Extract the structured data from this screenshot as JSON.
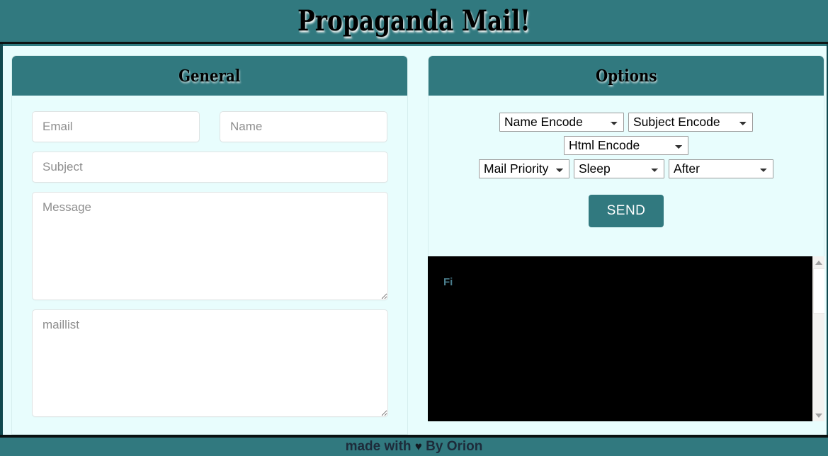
{
  "app": {
    "title": "Propaganda Mail!",
    "theme": {
      "teal": "#31797f",
      "panel_bg": "#e8fdfd",
      "console_bg": "#000000",
      "console_text": "#4a7d8c",
      "input_border": "#dfe4e4",
      "placeholder": "#8e8e8e"
    }
  },
  "general": {
    "heading": "General",
    "fields": {
      "email_placeholder": "Email",
      "name_placeholder": "Name",
      "subject_placeholder": "Subject",
      "message_placeholder": "Message",
      "maillist_placeholder": "maillist",
      "email_value": "",
      "name_value": "",
      "subject_value": "",
      "message_value": "",
      "maillist_value": ""
    }
  },
  "options": {
    "heading": "Options",
    "selects": [
      {
        "name": "name-encode",
        "selected": "Name Encode"
      },
      {
        "name": "subject-encode",
        "selected": "Subject Encode"
      },
      {
        "name": "html-encode",
        "selected": "Html Encode"
      },
      {
        "name": "mail-priority",
        "selected": "Mail Priority"
      },
      {
        "name": "sleep",
        "selected": "Sleep"
      },
      {
        "name": "after",
        "selected": "After"
      }
    ],
    "send_label": "SEND"
  },
  "console": {
    "output": "Fi"
  },
  "footer": {
    "prefix": "made with",
    "heart": "♥",
    "suffix": "By Orion"
  }
}
